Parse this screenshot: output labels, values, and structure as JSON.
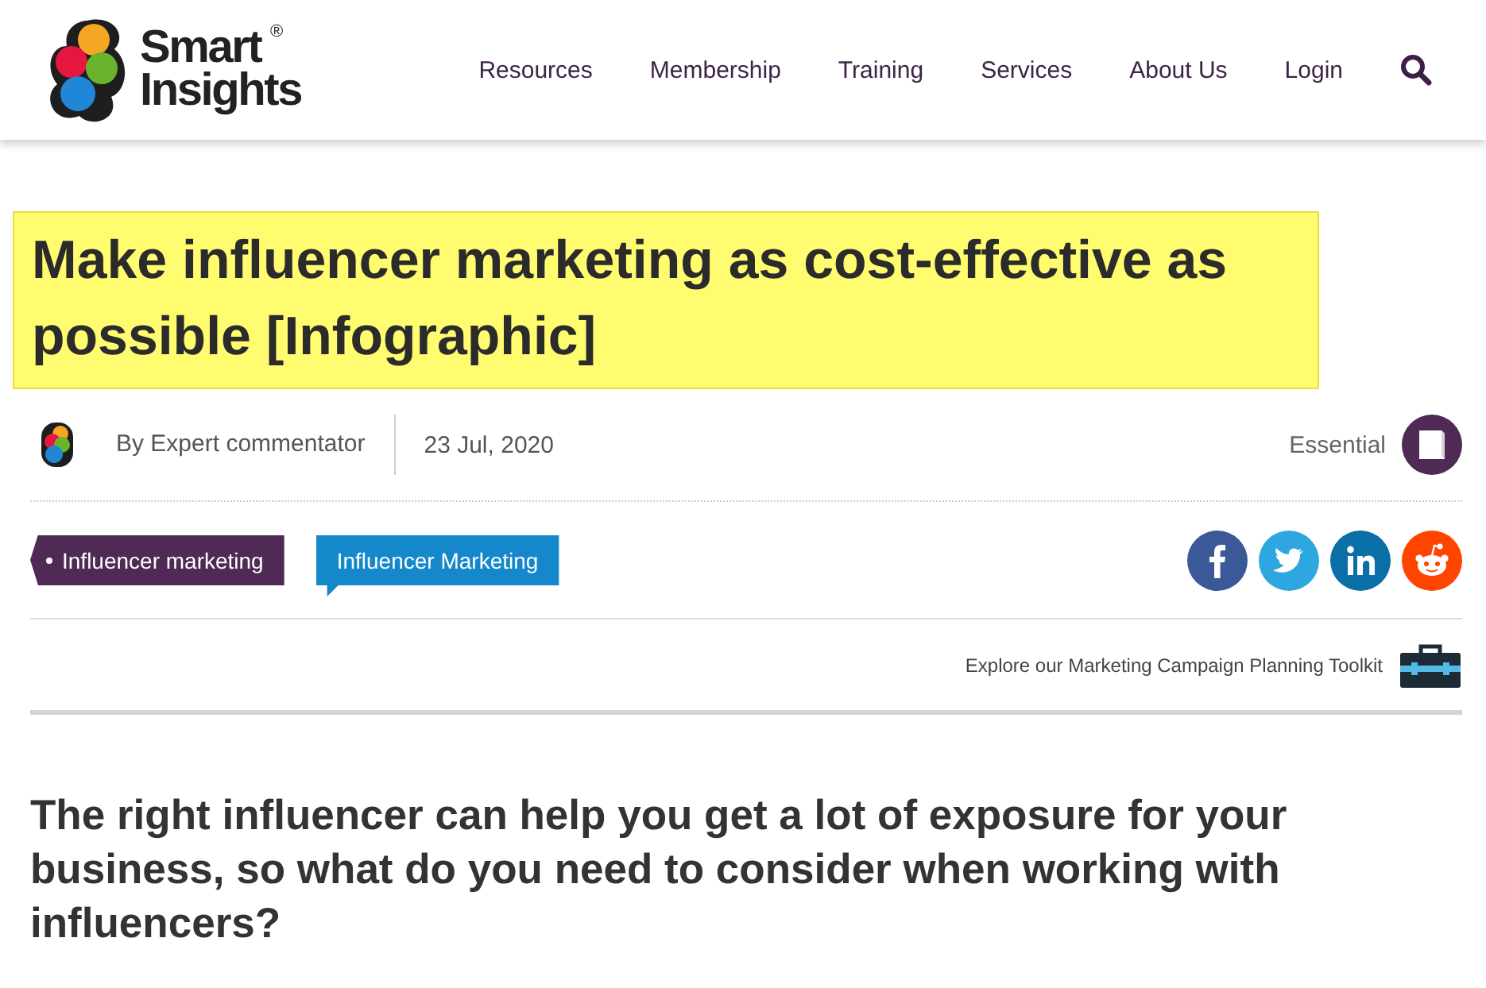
{
  "logo": {
    "line_1": "Smart",
    "line_2": "Insights",
    "mark": "®"
  },
  "nav": {
    "items": [
      "Resources",
      "Membership",
      "Training",
      "Services",
      "About Us",
      "Login"
    ]
  },
  "article": {
    "title": "Make influencer marketing as cost-effective as possible [Infographic]",
    "author": "By Expert commentator",
    "date": "23 Jul, 2020",
    "level": "Essential",
    "tags": [
      {
        "label": "Influencer marketing",
        "kind": "category"
      },
      {
        "label": "Influencer Marketing",
        "kind": "topic"
      }
    ],
    "share": [
      {
        "kind": "facebook",
        "color": "#3b5998"
      },
      {
        "kind": "twitter",
        "color": "#2ea7e0"
      },
      {
        "kind": "linkedin",
        "color": "#0a6fa6"
      },
      {
        "kind": "reddit",
        "color": "#fe4500"
      }
    ],
    "toolkit": "Explore our Marketing Campaign Planning Toolkit",
    "intro": "The right influencer can help you get a lot of exposure for your business, so what do you need to consider when working with influencers?"
  }
}
